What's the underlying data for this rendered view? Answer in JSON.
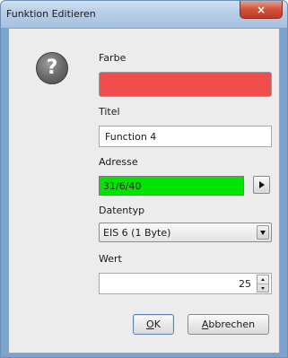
{
  "window": {
    "title": "Funktion Editieren",
    "close_glyph": "×"
  },
  "icon": {
    "question_glyph": "?"
  },
  "form": {
    "color_label": "Farbe",
    "color_value": "#f24d4d",
    "title_label": "Titel",
    "title_value": "Function 4",
    "address_label": "Adresse",
    "address_value": "31/6/40",
    "datatype_label": "Datentyp",
    "datatype_value": "EIS 6 (1 Byte)",
    "value_label": "Wert",
    "value_value": "25"
  },
  "buttons": {
    "ok_mnemonic": "O",
    "ok_rest": "K",
    "cancel_mnemonic": "A",
    "cancel_rest": "bbrechen"
  },
  "colors": {
    "address_bg": "#00e400",
    "swatch": "#f24d4d"
  }
}
